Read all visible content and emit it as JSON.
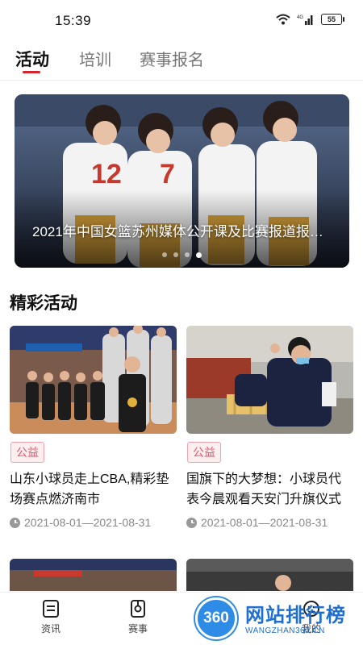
{
  "status_bar": {
    "time": "15:39",
    "battery": "55",
    "icons": [
      "wifi-icon",
      "signal-4g-icon",
      "battery-icon"
    ]
  },
  "tabs": [
    {
      "label": "活动",
      "active": true
    },
    {
      "label": "培训",
      "active": false
    },
    {
      "label": "赛事报名",
      "active": false
    }
  ],
  "banner": {
    "caption": "2021年中国女篮苏州媒体公开课及比赛报道报…",
    "dots": 4,
    "active_dot": 4
  },
  "section": {
    "title": "精彩活动"
  },
  "cards": [
    {
      "tag": "公益",
      "title": "山东小球员走上CBA,精彩垫场赛点燃济南市",
      "date": "2021-08-01—2021-08-31"
    },
    {
      "tag": "公益",
      "title": "国旗下的大梦想：小球员代表今晨观看天安门升旗仪式",
      "date": "2021-08-01—2021-08-31"
    }
  ],
  "bottom_nav": [
    {
      "label": "资讯",
      "icon": "news-icon"
    },
    {
      "label": "赛事",
      "icon": "match-icon"
    },
    {
      "label": "视",
      "icon": "video-icon"
    },
    {
      "label": "我的",
      "icon": "profile-icon"
    }
  ],
  "watermark": {
    "logo": "360",
    "text": "网站排行榜",
    "sub": "WANGZHAN360.CN"
  },
  "colors": {
    "accent": "#d8232a",
    "tag_text": "#e0566b",
    "tag_bg": "#fdeef0"
  }
}
